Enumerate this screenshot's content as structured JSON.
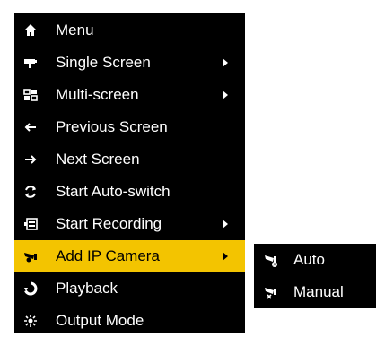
{
  "menu": {
    "items": [
      {
        "label": "Menu",
        "icon": "home-icon",
        "has_submenu": false
      },
      {
        "label": "Single Screen",
        "icon": "single-screen-icon",
        "has_submenu": true
      },
      {
        "label": "Multi-screen",
        "icon": "multi-screen-icon",
        "has_submenu": true
      },
      {
        "label": "Previous Screen",
        "icon": "arrow-left-icon",
        "has_submenu": false
      },
      {
        "label": "Next Screen",
        "icon": "arrow-right-icon",
        "has_submenu": false
      },
      {
        "label": "Start Auto-switch",
        "icon": "auto-switch-icon",
        "has_submenu": false
      },
      {
        "label": "Start Recording",
        "icon": "recording-icon",
        "has_submenu": true
      },
      {
        "label": "Add IP Camera",
        "icon": "ip-camera-icon",
        "has_submenu": true,
        "highlighted": true
      },
      {
        "label": "Playback",
        "icon": "playback-icon",
        "has_submenu": false
      },
      {
        "label": "Output Mode",
        "icon": "output-mode-icon",
        "has_submenu": false
      }
    ]
  },
  "submenu": {
    "items": [
      {
        "label": "Auto",
        "icon": "auto-camera-icon"
      },
      {
        "label": "Manual",
        "icon": "manual-camera-icon"
      }
    ]
  },
  "colors": {
    "menu_background": "#000000",
    "highlight": "#f3c400",
    "text": "#ffffff"
  }
}
